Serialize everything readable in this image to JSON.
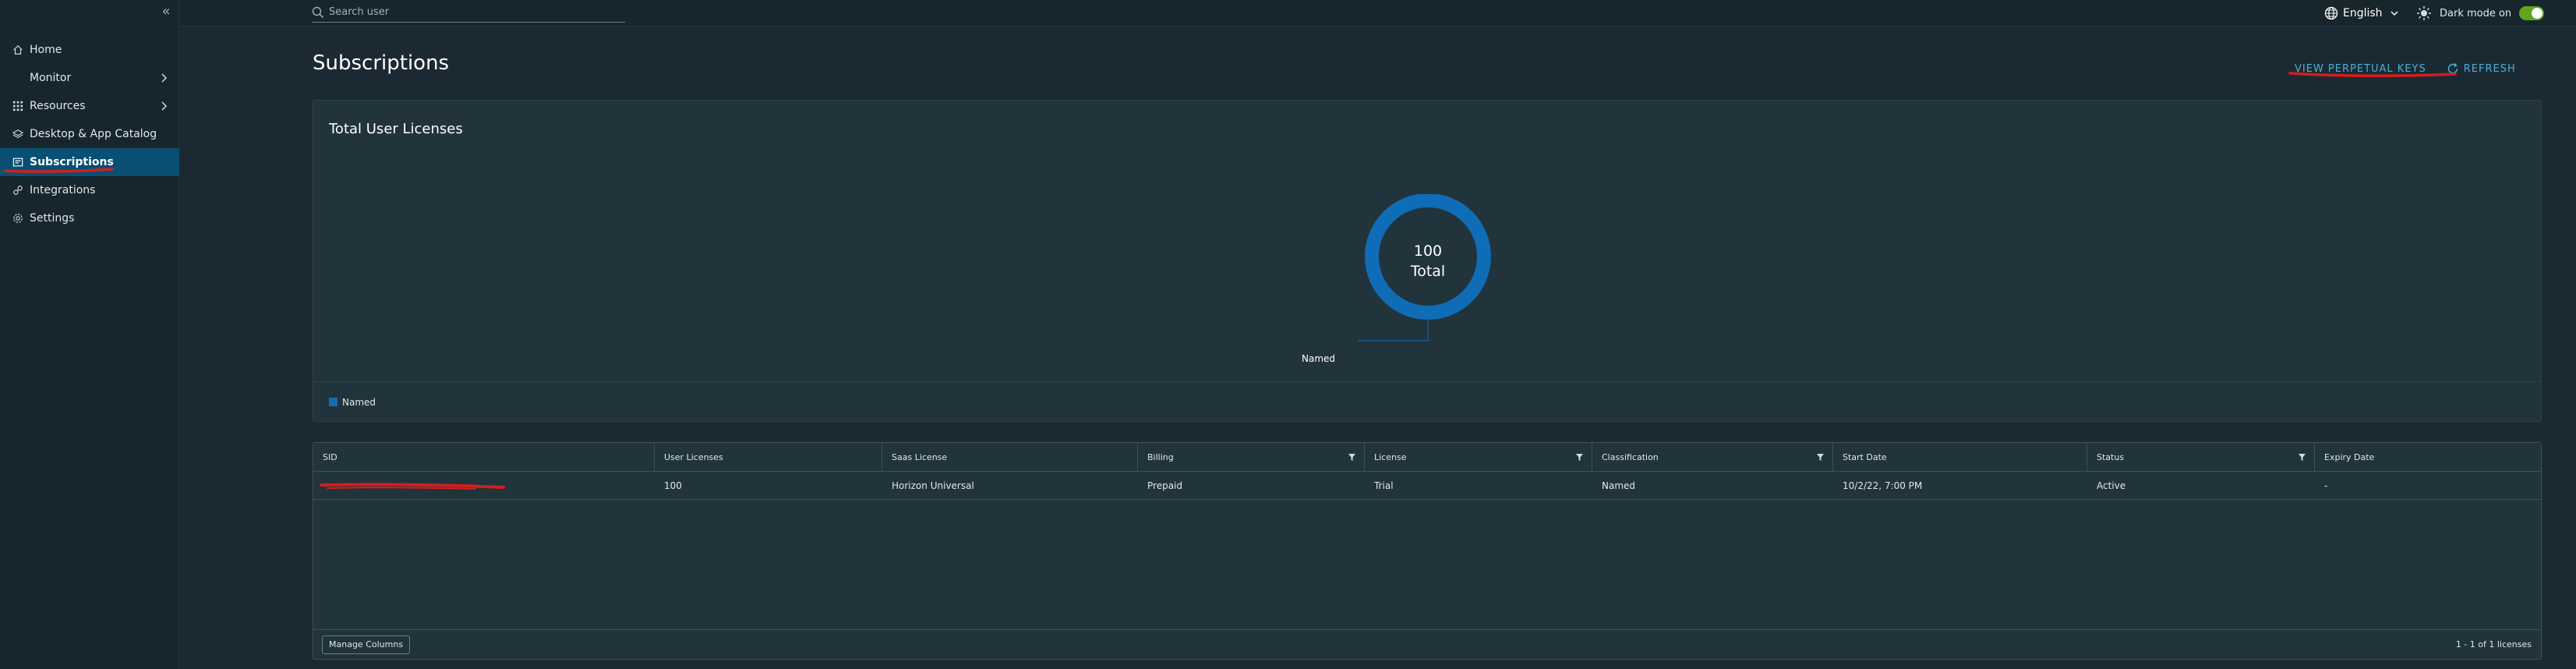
{
  "sidebar": {
    "collapse_icon": "double-chevron-left-icon",
    "items": [
      {
        "label": "Home",
        "icon": "home-icon"
      },
      {
        "label": "Monitor",
        "icon": "monitor-icon"
      },
      {
        "label": "Resources",
        "icon": "grid-icon"
      },
      {
        "label": "Desktop & App Catalog",
        "icon": "layers-icon"
      },
      {
        "label": "Subscriptions",
        "icon": "subscription-icon",
        "active": true
      },
      {
        "label": "Integrations",
        "icon": "integration-icon"
      },
      {
        "label": "Settings",
        "icon": "gear-icon"
      }
    ]
  },
  "topbar": {
    "search_placeholder": "Search user",
    "language": "English",
    "dark_mode_label": "Dark mode on",
    "dark_mode_on": true
  },
  "page": {
    "title": "Subscriptions",
    "view_keys_label": "VIEW PERPETUAL KEYS",
    "refresh_label": "REFRESH"
  },
  "card": {
    "title": "Total User Licenses",
    "total_value": "100",
    "total_label": "Total",
    "legend": [
      {
        "label": "Named",
        "color": "#0f6cb6"
      }
    ]
  },
  "chart_data": {
    "type": "pie",
    "title": "Total User Licenses",
    "categories": [
      "Named"
    ],
    "values": [
      100
    ],
    "colors": [
      "#0f6cb6"
    ],
    "center_text": [
      "100",
      "Total"
    ],
    "legend_position": "bottom-left"
  },
  "table": {
    "columns": [
      "SID",
      "User Licenses",
      "Saas License",
      "Billing",
      "License",
      "Classification",
      "Start Date",
      "Status",
      "Expiry Date"
    ],
    "rows": [
      {
        "sid": "",
        "user_licenses": "100",
        "saas_license": "Horizon Universal",
        "billing": "Prepaid",
        "license": "Trial",
        "classification": "Named",
        "start_date": "10/2/22, 7:00 PM",
        "status": "Active",
        "expiry_date": "-"
      }
    ],
    "manage_columns_label": "Manage Columns",
    "footer_count": "1 - 1 of 1 licenses"
  },
  "colors": {
    "accent": "#49afd9",
    "active_nav": "#074f73",
    "chart_blue": "#0f6cb6",
    "annotation_red": "#d41e1e",
    "toggle_green": "#62a420"
  }
}
